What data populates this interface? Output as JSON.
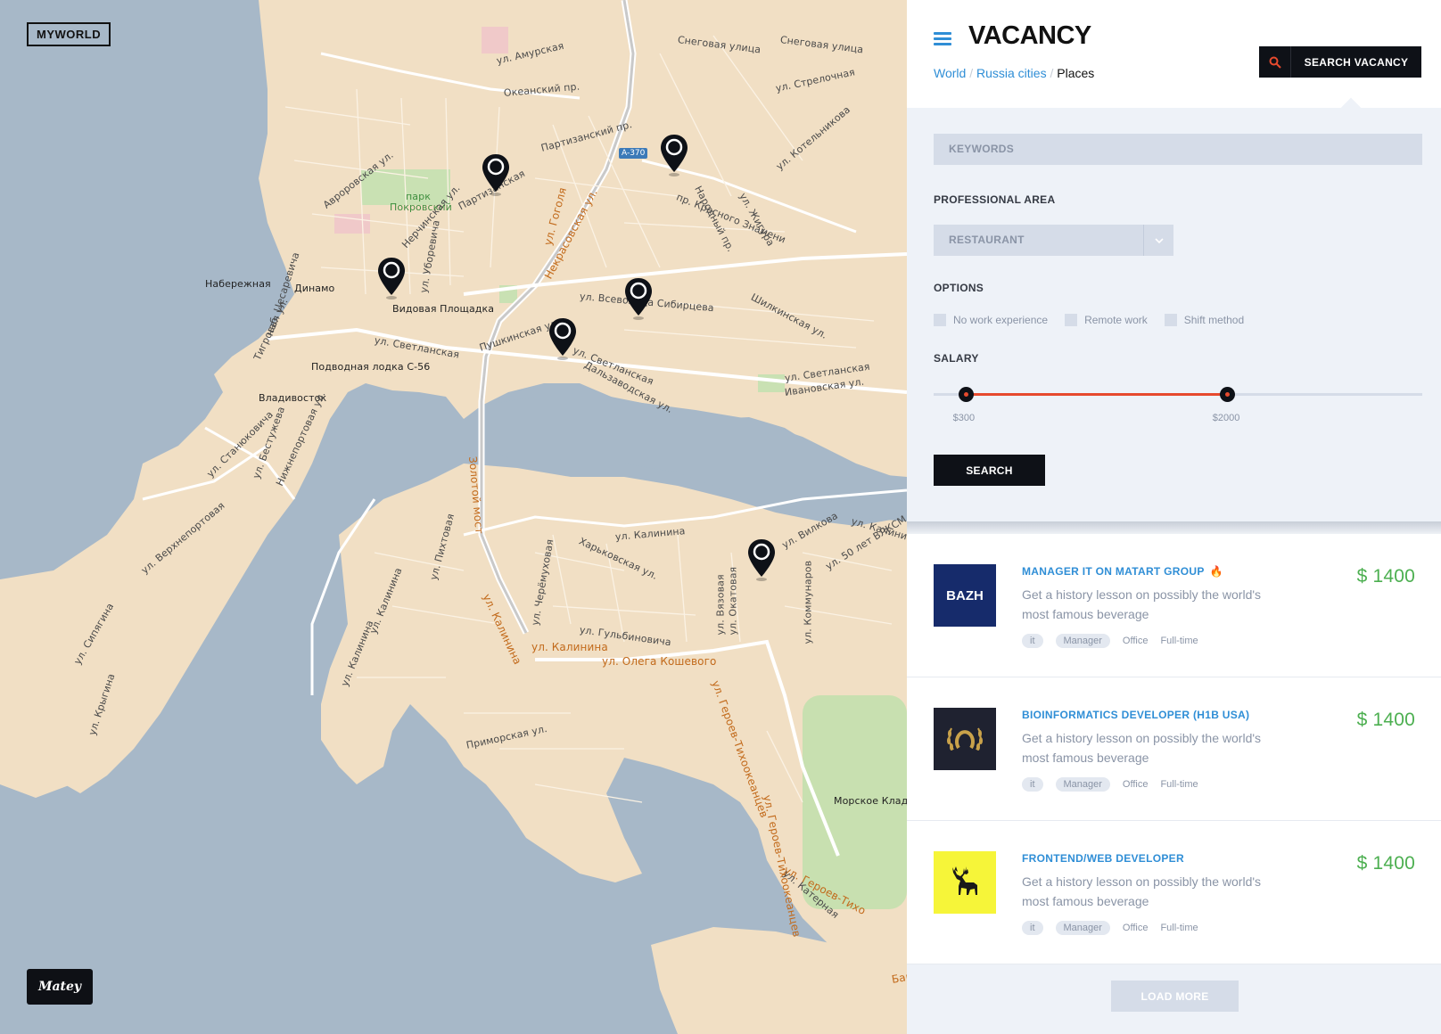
{
  "brand": {
    "name": "MYWORLD",
    "bottom_logo": "Matey"
  },
  "map": {
    "road_badge": "A-370",
    "labels": [
      {
        "text": "ул. Амурская",
        "cls": ""
      },
      {
        "text": "Океанский пр.",
        "cls": ""
      },
      {
        "text": "Снеговая улица",
        "cls": ""
      },
      {
        "text": "Снеговая улица",
        "cls": ""
      },
      {
        "text": "ул. Стрелочная",
        "cls": ""
      },
      {
        "text": "Партизанский пр.",
        "cls": ""
      },
      {
        "text": "Авроровская ул.",
        "cls": ""
      },
      {
        "text": "парк",
        "cls": "park"
      },
      {
        "text": "Покровский",
        "cls": "park"
      },
      {
        "text": "Нерчинская ул.",
        "cls": ""
      },
      {
        "text": "ул. Гоголя",
        "cls": "main"
      },
      {
        "text": "Некрасовская ул.",
        "cls": "main"
      },
      {
        "text": "пр. Красного Знамени",
        "cls": ""
      },
      {
        "text": "Народный пр.",
        "cls": ""
      },
      {
        "text": "ул. Жигура",
        "cls": ""
      },
      {
        "text": "ул. Котельникова",
        "cls": ""
      },
      {
        "text": "Набережная",
        "cls": "dark"
      },
      {
        "text": "Динамо",
        "cls": "dark"
      },
      {
        "text": "Видовая Площадка",
        "cls": "dark"
      },
      {
        "text": "ул. Всеволода Сибирцева",
        "cls": ""
      },
      {
        "text": "Шилкинская ул.",
        "cls": ""
      },
      {
        "text": "ул. Светланская",
        "cls": ""
      },
      {
        "text": "Пушкинская ул.",
        "cls": ""
      },
      {
        "text": "ул. Светланская",
        "cls": ""
      },
      {
        "text": "Дальзаводская ул.",
        "cls": ""
      },
      {
        "text": "Подводная лодка С-56",
        "cls": "dark"
      },
      {
        "text": "Владивосток",
        "cls": "dark"
      },
      {
        "text": "ул. Светланская",
        "cls": ""
      },
      {
        "text": "Ивановская ул.",
        "cls": ""
      },
      {
        "text": "Золотой мост",
        "cls": "main"
      },
      {
        "text": "ул. Станюковича",
        "cls": ""
      },
      {
        "text": "ул. Бестужева",
        "cls": ""
      },
      {
        "text": "Нижнепортовая ул.",
        "cls": ""
      },
      {
        "text": "ул. Верхнепортовая",
        "cls": ""
      },
      {
        "text": "ул. Калинина",
        "cls": ""
      },
      {
        "text": "Харьковская ул.",
        "cls": ""
      },
      {
        "text": "ул. Вилкова",
        "cls": ""
      },
      {
        "text": "ул. 50 лет ВЛКСМ",
        "cls": ""
      },
      {
        "text": "ул. Калинина",
        "cls": ""
      },
      {
        "text": "ул. Калинина",
        "cls": "main"
      },
      {
        "text": "ул. Черёмуховая",
        "cls": ""
      },
      {
        "text": "ул. Гульбиновича",
        "cls": ""
      },
      {
        "text": "ул. Вязовая",
        "cls": ""
      },
      {
        "text": "ул. Окатовая",
        "cls": ""
      },
      {
        "text": "ул. Коммунаров",
        "cls": ""
      },
      {
        "text": "ул. Калинина",
        "cls": "main"
      },
      {
        "text": "ул. Олега Кошевого",
        "cls": "main"
      },
      {
        "text": "ул. Героев-Тихоокеанцев",
        "cls": "main"
      },
      {
        "text": "ул. Сипягина",
        "cls": ""
      },
      {
        "text": "ул. Крыгина",
        "cls": ""
      },
      {
        "text": "Приморская ул.",
        "cls": ""
      },
      {
        "text": "Морское Кладбище",
        "cls": "dark"
      },
      {
        "text": "ул. Героев-Тихоокеанцев",
        "cls": "main"
      },
      {
        "text": "ул. Героев-Тихо",
        "cls": "main"
      },
      {
        "text": "ул. Катерная",
        "cls": ""
      },
      {
        "text": "Бархатна",
        "cls": "main"
      },
      {
        "text": "ул. Пихтовая",
        "cls": ""
      },
      {
        "text": "ул. Калинина",
        "cls": ""
      },
      {
        "text": "ул. Калинина",
        "cls": ""
      },
      {
        "text": "Тигровая ул.",
        "cls": ""
      },
      {
        "text": "наб. Цесаревича",
        "cls": ""
      },
      {
        "text": "ул. Уборевича",
        "cls": ""
      },
      {
        "text": "Партизанская",
        "cls": ""
      }
    ]
  },
  "panel": {
    "title": "VACANCY",
    "breadcrumb": [
      "World",
      "Russia cities",
      "Places"
    ],
    "breadcrumb_sep": "/",
    "search_button": "SEARCH VACANCY",
    "filter": {
      "keywords_placeholder": "KEYWORDS",
      "area_label": "PROFESSIONAL AREA",
      "area_value": "RESTAURANT",
      "options_label": "OPTIONS",
      "options": [
        "No work experience",
        "Remote work",
        "Shift method"
      ],
      "salary_label": "SALARY",
      "salary_min": "$300",
      "salary_max": "$2000",
      "salary_min_frac": 0.065,
      "salary_max_frac": 0.6,
      "search_label": "SEARCH"
    },
    "jobs": [
      {
        "title": "MANAGER IT ON MATART GROUP",
        "hot": true,
        "desc": "Get a history lesson on possibly the world's most famous beverage",
        "price": "$ 1400",
        "logo_text": "BAZH",
        "logo_bg": "#162b6b",
        "tags": [
          "it",
          "Manager"
        ],
        "plain": [
          "Office",
          "Full-time"
        ]
      },
      {
        "title": "BIOINFORMATICS DEVELOPER (H1B USA)",
        "hot": false,
        "desc": "Get a history lesson on possibly the world's most famous beverage",
        "price": "$ 1400",
        "logo_text": "",
        "logo_bg": "#1f2230",
        "tags": [
          "it",
          "Manager"
        ],
        "plain": [
          "Office",
          "Full-time"
        ]
      },
      {
        "title": "FRONTEND/WEB DEVELOPER",
        "hot": false,
        "desc": "Get a history lesson on possibly the world's most famous beverage",
        "price": "$ 1400",
        "logo_text": "",
        "logo_bg": "#f6f539",
        "tags": [
          "it",
          "Manager"
        ],
        "plain": [
          "Office",
          "Full-time"
        ]
      }
    ],
    "load_more": "LOAD MORE"
  },
  "colors": {
    "accent": "#2f8ed6",
    "price": "#4caf50",
    "slider": "#e64a2e",
    "dark": "#0e1117",
    "water": "#a7b8c8",
    "land": "#f1dfc4"
  },
  "icons": [
    "hamburger-icon",
    "search-icon",
    "chevron-down-icon",
    "flame-icon",
    "map-pin-icon"
  ]
}
